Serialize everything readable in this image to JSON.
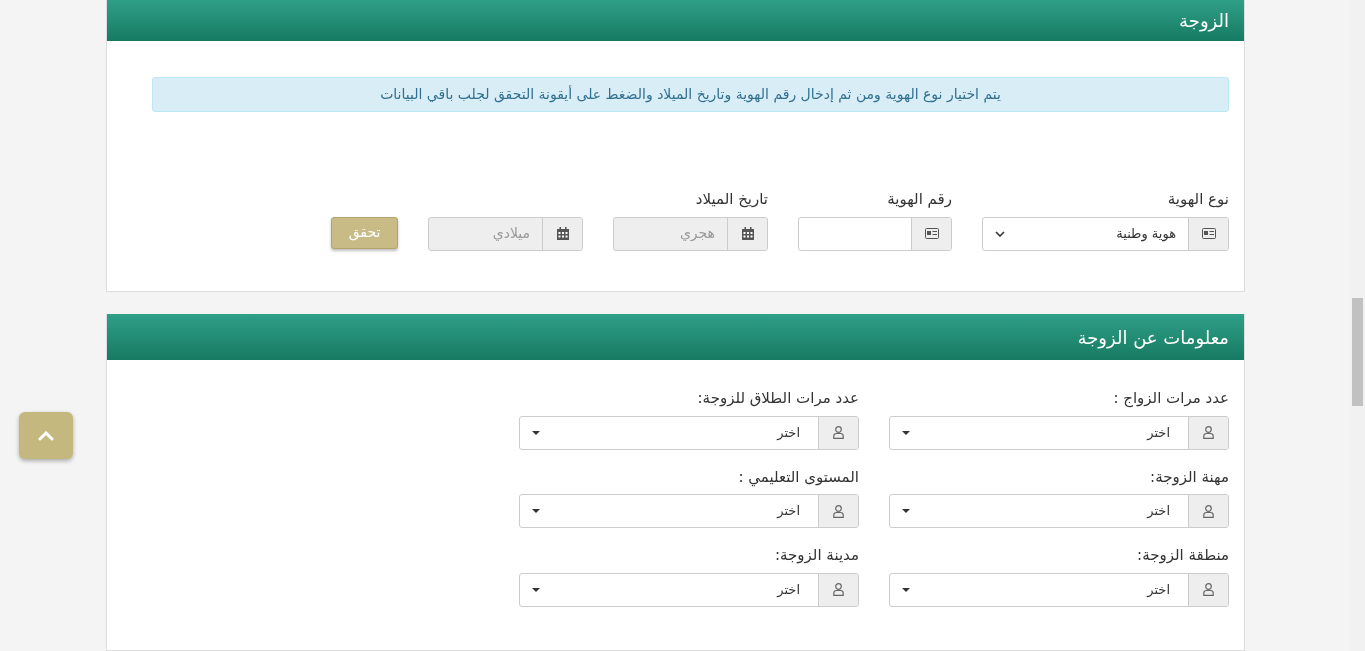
{
  "identity_panel": {
    "title": "الزوجة",
    "notice": "يتم اختيار نوع الهوية ومن ثم إدخال رقم الهوية وتاريخ الميلاد والضغط على أيقونة التحقق لجلب باقي البيانات",
    "id_type": {
      "label": "نوع الهوية",
      "value": "هوية وطنية"
    },
    "id_number": {
      "label": "رقم الهوية"
    },
    "birth_date": {
      "label": "تاريخ الميلاد",
      "inputs": [
        {
          "placeholder": "هجري",
          "disabled": true
        },
        {
          "placeholder": "ميلادي",
          "disabled": true
        }
      ]
    },
    "verify_button": "تحقق"
  },
  "info_panel": {
    "title": "معلومات عن الزوجة",
    "fields": [
      {
        "label": "عدد مرات الزواج :",
        "value": "اختر"
      },
      {
        "label": "عدد مرات الطلاق للزوجة:",
        "value": "اختر"
      },
      {
        "label": "مهنة الزوجة:",
        "value": "اختر"
      },
      {
        "label": "المستوى التعليمي :",
        "value": "اختر"
      },
      {
        "label": "منطقة الزوجة:",
        "value": "اختر"
      },
      {
        "label": "مدينة الزوجة:",
        "value": "اختر"
      }
    ]
  }
}
